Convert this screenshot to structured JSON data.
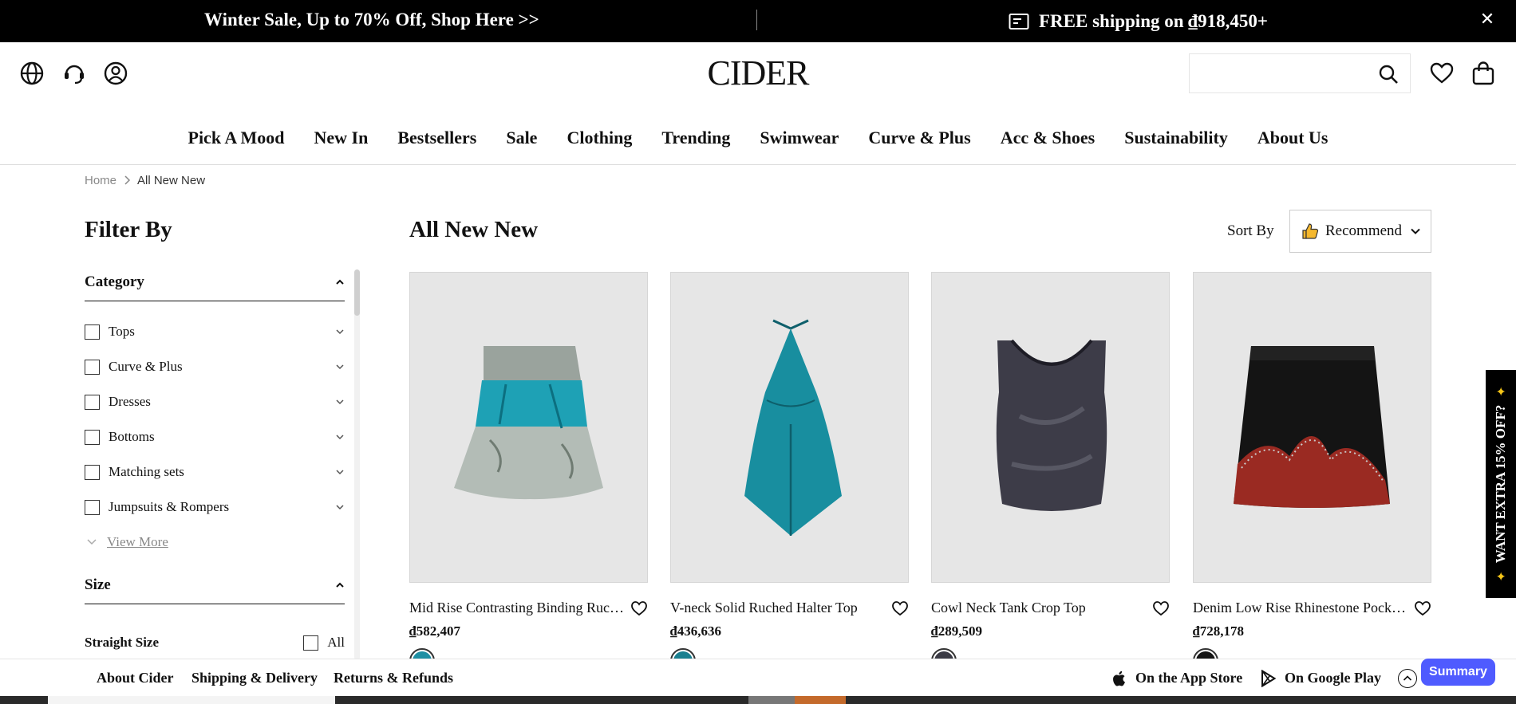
{
  "topbar": {
    "promo_left": "Winter Sale, Up to 70% Off, Shop Here >>",
    "promo_right": "FREE shipping on ₫918,450+",
    "close_icon": "close-icon"
  },
  "header": {
    "logo": "CIDER",
    "icons": [
      "globe-icon",
      "support-icon",
      "account-icon",
      "search-icon",
      "heart-icon",
      "bag-icon"
    ],
    "search_placeholder": ""
  },
  "nav": {
    "items": [
      "Pick A Mood",
      "New In",
      "Bestsellers",
      "Sale",
      "Clothing",
      "Trending",
      "Swimwear",
      "Curve & Plus",
      "Acc & Shoes",
      "Sustainability",
      "About Us"
    ]
  },
  "breadcrumb": {
    "home": "Home",
    "current": "All New New"
  },
  "sidebar": {
    "title": "Filter By",
    "category_label": "Category",
    "categories": [
      "Tops",
      "Curve & Plus",
      "Dresses",
      "Bottoms",
      "Matching sets",
      "Jumpsuits & Rompers"
    ],
    "view_more": "View More",
    "size_label": "Size",
    "straight_size": "Straight Size",
    "all_label": "All"
  },
  "main": {
    "title": "All New New",
    "sort_label": "Sort By",
    "sort_value": "Recommend",
    "products": [
      {
        "name": "Mid Rise Contrasting Binding Ruched Drawstring Mini Skirt",
        "price": "₫582,407",
        "swatch_color": "#1f8fa3"
      },
      {
        "name": "V-neck Solid Ruched Halter Top",
        "price": "₫436,636",
        "swatch_color": "#1a7f8f"
      },
      {
        "name": "Cowl Neck Tank Crop Top",
        "price": "₫289,509",
        "swatch_color": "#3b3b45"
      },
      {
        "name": "Denim Low Rise Rhinestone Pocket Mini Skirt",
        "price": "₫728,178",
        "swatch_color": "#151515"
      }
    ]
  },
  "side_promo": {
    "text": "WANT EXTRA 15% OFF?"
  },
  "footer": {
    "links": [
      "About Cider",
      "Shipping & Delivery",
      "Returns & Refunds"
    ],
    "app_store": "On the App Store",
    "google_play": "On Google Play",
    "summary": "Summary"
  },
  "colors": {
    "topbar_bg": "#000000",
    "summary_bg": "#4f5bff",
    "product_bg": "#e6e6e6"
  }
}
